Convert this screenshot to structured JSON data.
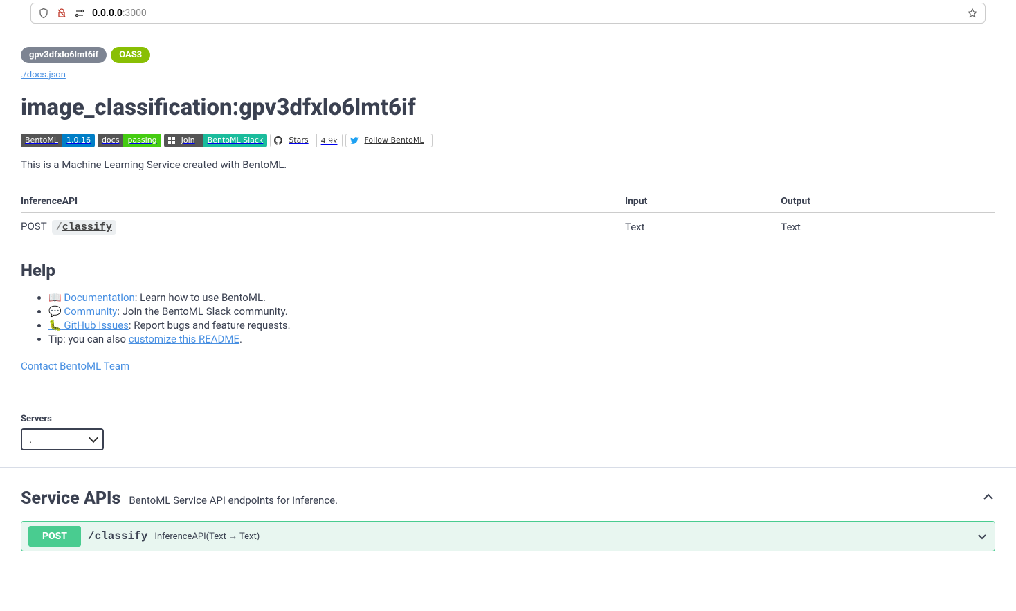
{
  "url": {
    "host": "0.0.0.0",
    "port": ":3000"
  },
  "header": {
    "api_id": "gpv3dfxlo6lmt6if",
    "oas_version": "OAS3",
    "docs_link": "./docs.json",
    "title": "image_classification:gpv3dfxlo6lmt6if"
  },
  "shields": {
    "bentoml": {
      "left": "BentoML",
      "right": "1.0.16"
    },
    "docs": {
      "left": "docs",
      "right": "passing"
    },
    "slack": {
      "left": "Join",
      "right": "BentoML Slack"
    },
    "github": {
      "left": "Stars",
      "right": "4.9k"
    },
    "twitter": {
      "text": "Follow BentoML"
    }
  },
  "description": "This is a Machine Learning Service created with BentoML.",
  "api_table": {
    "headers": {
      "name": "InferenceAPI",
      "input": "Input",
      "output": "Output"
    },
    "rows": [
      {
        "method": "POST",
        "path": "/classify",
        "input": "Text",
        "output": "Text"
      }
    ]
  },
  "help": {
    "title": "Help",
    "items": [
      {
        "icon": "📖",
        "link": "Documentation",
        "suffix": ": Learn how to use BentoML."
      },
      {
        "icon": "💬",
        "link": "Community",
        "suffix": ": Join the BentoML Slack community."
      },
      {
        "icon": "🐛",
        "link": "GitHub Issues",
        "suffix": ": Report bugs and feature requests."
      }
    ],
    "tip_prefix": "Tip: you can also ",
    "tip_link": "customize this README",
    "tip_suffix": "."
  },
  "contact": "Contact BentoML Team",
  "servers": {
    "label": "Servers",
    "selected": "."
  },
  "service_apis": {
    "title": "Service APIs",
    "description": "BentoML Service API endpoints for inference.",
    "operations": [
      {
        "method": "POST",
        "path": "/classify",
        "summary": "InferenceAPI(Text → Text)"
      }
    ]
  }
}
